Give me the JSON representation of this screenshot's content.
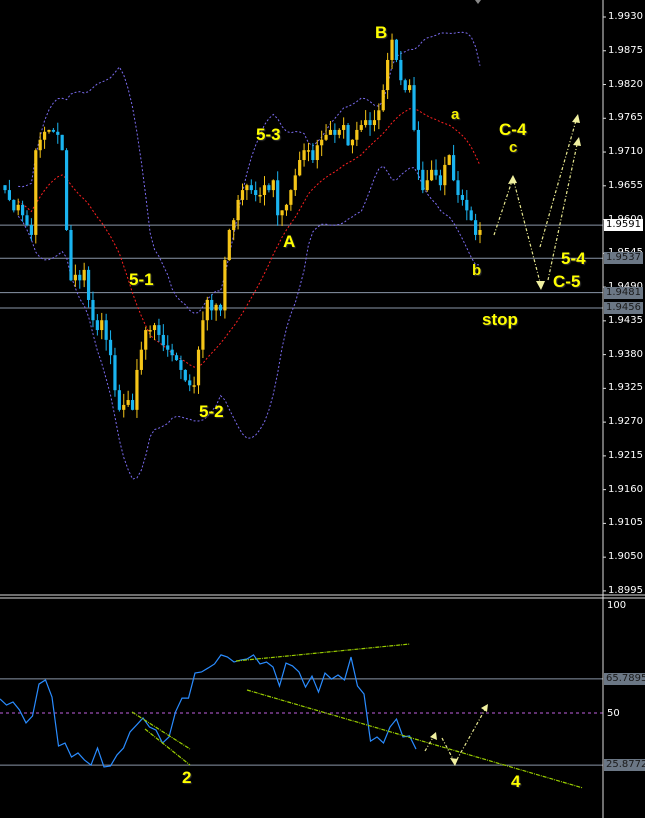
{
  "chart_data": [
    {
      "type": "candlestick",
      "title": "",
      "ylim": [
        1.8995,
        1.993
      ],
      "y_ticks": [
        "1.9930",
        "1.9875",
        "1.9820",
        "1.9765",
        "1.9710",
        "1.9655",
        "1.9600",
        "1.9545",
        "1.9490",
        "1.9435",
        "1.9380",
        "1.9325",
        "1.9270",
        "1.9215",
        "1.9160",
        "1.9105",
        "1.9050",
        "1.8995"
      ],
      "closes": [
        1.9648,
        1.9632,
        1.9615,
        1.9624,
        1.9607,
        1.9591,
        1.9575,
        1.9713,
        1.973,
        1.9743,
        1.9746,
        1.9743,
        1.9738,
        1.9713,
        1.9583,
        1.9501,
        1.951,
        1.9501,
        1.9518,
        1.9469,
        1.9436,
        1.942,
        1.9436,
        1.9404,
        1.9379,
        1.9322,
        1.929,
        1.9298,
        1.9306,
        1.929,
        1.9355,
        1.9388,
        1.942,
        1.942,
        1.9428,
        1.9412,
        1.9395,
        1.9388,
        1.9379,
        1.9371,
        1.9355,
        1.9338,
        1.933,
        1.933,
        1.9388,
        1.9436,
        1.9469,
        1.9452,
        1.9461,
        1.9452,
        1.9534,
        1.9583,
        1.9599,
        1.9632,
        1.9648,
        1.9656,
        1.9648,
        1.964,
        1.964,
        1.9656,
        1.9648,
        1.9664,
        1.9607,
        1.9615,
        1.9624,
        1.9648,
        1.9672,
        1.9697,
        1.9713,
        1.9713,
        1.9697,
        1.9721,
        1.973,
        1.9738,
        1.9746,
        1.9738,
        1.9746,
        1.9754,
        1.9721,
        1.973,
        1.9746,
        1.9754,
        1.9762,
        1.9754,
        1.9762,
        1.9778,
        1.9811,
        1.986,
        1.9893,
        1.986,
        1.9827,
        1.9811,
        1.9819,
        1.9746,
        1.9681,
        1.9648,
        1.9664,
        1.9681,
        1.9672,
        1.9656,
        1.9689,
        1.9705,
        1.9664,
        1.964,
        1.9632,
        1.9615,
        1.9599,
        1.9575,
        1.9583
      ],
      "horizontal_levels": [
        {
          "value": "1.9591",
          "style": "current"
        },
        {
          "value": "1.9537",
          "style": "level"
        },
        {
          "value": "1.9481",
          "style": "level"
        },
        {
          "value": "1.9456",
          "style": "level"
        }
      ],
      "annotations": {
        "b_upper": "B",
        "w53": "5-3",
        "a_upper": "A",
        "w51": "5-1",
        "w52": "5-2",
        "a_lower": "a",
        "c4": "C-4",
        "c_lower": "c",
        "b_lower": "b",
        "w54": "5-4",
        "c5": "C-5",
        "stop": "stop"
      },
      "colors": {
        "bull": "#f5c518",
        "bear": "#1ab4f0",
        "ma": "#ff2020",
        "bands": "#7b6cf0",
        "levels": "#8a96a8"
      }
    },
    {
      "type": "line",
      "title": "",
      "ylim": [
        0,
        100
      ],
      "y_ticks": [
        "100",
        "50"
      ],
      "levels": [
        "65.7895",
        "25.8772"
      ],
      "values": [
        56.5,
        53.7,
        55.1,
        51.4,
        45.4,
        48.6,
        63.4,
        65.3,
        57.4,
        34.7,
        36.1,
        29.6,
        31.5,
        28.2,
        25.9,
        33.8,
        25.0,
        25.5,
        30.6,
        33.8,
        41.2,
        44.4,
        47.7,
        43.5,
        42.1,
        36.1,
        38.9,
        50.5,
        56.9,
        56.9,
        68.5,
        69.0,
        70.8,
        72.7,
        76.9,
        75.9,
        73.6,
        74.5,
        75.0,
        76.9,
        72.7,
        73.6,
        71.3,
        62.5,
        73.1,
        71.8,
        69.0,
        62.0,
        67.1,
        59.7,
        68.5,
        65.7,
        67.6,
        65.3,
        75.9,
        62.5,
        58.8,
        37.0,
        38.9,
        36.1,
        43.5,
        47.2,
        38.9,
        39.4,
        33.3
      ],
      "annotations": {
        "w2": "2",
        "w4": "4"
      },
      "colors": {
        "line": "#2a8cff",
        "trend": "#9acd00",
        "mid": "#c060e0"
      }
    }
  ]
}
